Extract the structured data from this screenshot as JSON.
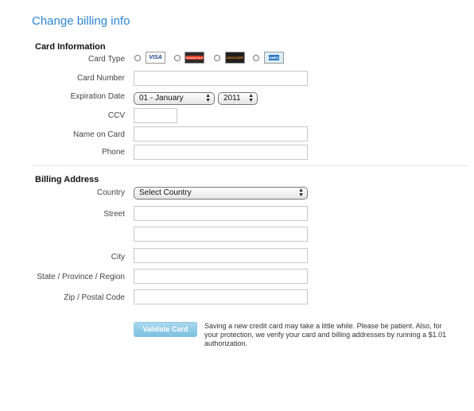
{
  "page": {
    "title": "Change billing info"
  },
  "card_section": {
    "title": "Card Information",
    "card_type_label": "Card Type",
    "card_types": [
      {
        "name": "Visa",
        "logo_text": "VISA",
        "color": "#1a3e8c"
      },
      {
        "name": "MasterCard",
        "logo_text": "MasterCard",
        "color": "#e43a24"
      },
      {
        "name": "Discover",
        "logo_text": "DISCOVER",
        "color": "#f08a1d"
      },
      {
        "name": "American Express",
        "logo_text": "AMEX",
        "color": "#2a7bc0"
      }
    ],
    "card_number_label": "Card Number",
    "card_number_value": "",
    "expiration_label": "Expiration Date",
    "expiration_month": "01 - January",
    "expiration_year": "2011",
    "ccv_label": "CCV",
    "ccv_value": "",
    "name_label": "Name on Card",
    "name_value": "",
    "phone_label": "Phone",
    "phone_value": ""
  },
  "billing_section": {
    "title": "Billing Address",
    "country_label": "Country",
    "country_value": "Select Country",
    "street_label": "Street",
    "street_value": "",
    "street2_value": "",
    "city_label": "City",
    "city_value": "",
    "state_label": "State / Province / Region",
    "state_value": "",
    "zip_label": "Zip / Postal Code",
    "zip_value": ""
  },
  "actions": {
    "validate_label": "Validate Card",
    "note": "Saving a new credit card may take a little while. Please be patient. Also, for your protection, we verify your card and billing addresses by running a $1.01 authorization."
  }
}
